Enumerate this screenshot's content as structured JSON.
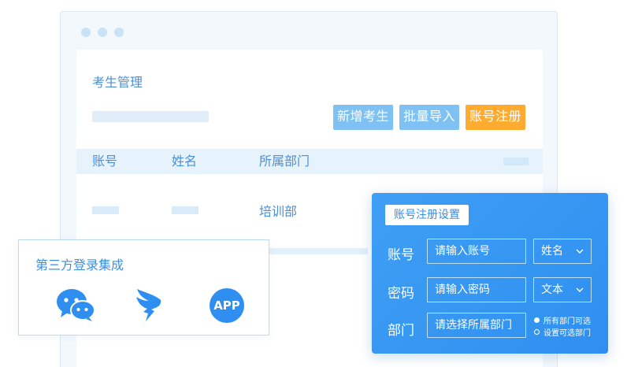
{
  "main": {
    "title": "考生管理",
    "buttons": {
      "add": "新增考生",
      "import": "批量导入",
      "register": "账号注册"
    },
    "table": {
      "columns": [
        "账号",
        "姓名",
        "所属部门"
      ],
      "rows": [
        {
          "dept": "培训部"
        }
      ]
    }
  },
  "third_party": {
    "title": "第三方登录集成",
    "icons": [
      "wechat-icon",
      "dingtalk-icon",
      "app-icon"
    ],
    "app_label": "APP"
  },
  "register_panel": {
    "title": "账号注册设置",
    "fields": [
      {
        "label": "账号",
        "placeholder": "请输入账号",
        "select": "姓名"
      },
      {
        "label": "密码",
        "placeholder": "请输入密码",
        "select": "文本"
      },
      {
        "label": "部门",
        "placeholder": "请选择所属部门"
      }
    ],
    "radio_options": [
      "所有部门可选",
      "设置可选部门"
    ],
    "radio_selected": 0
  },
  "colors": {
    "accent": "#2e8ff0",
    "light_button": "#7ec1f2",
    "warning_button": "#ffab2f",
    "text_blue": "#4b8fd6"
  }
}
